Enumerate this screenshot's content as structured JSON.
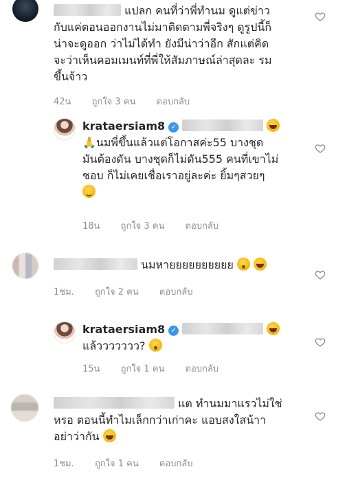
{
  "comments": [
    {
      "username": "",
      "lines": [
        "แปลก คนที่ว่าพี่ทำนม ดูแต่ข่าว",
        "กับแค่ตอนออกงานไม่มาติดตามพี่จริงๆ ดูรูปนี้ก็",
        "น่าจะดูออก ว่าไม่ได้ทำ ยังมีน่าว่าอีก สักแต่คิด",
        "จะว่าเห็นคอมเมนท์ที่พี่ให้สัมภาษณ์ล่าสุดละ รม",
        "ขึ้นจ้าว"
      ],
      "time": "42น",
      "likes": "ถูกใจ 3 คน",
      "reply": "ตอบกลับ"
    },
    {
      "username": "krataersiam8",
      "lines": [
        "นมพี่ขึ้นแล้วแต่โอกาสค่ะ55 บางชุด",
        "มันต้องดัน บางชุดก็ไม่ดัน555 คนที่เขาไม่",
        "ชอบ ก็ไม่เคยเชื่อเราอยู่ละค่ะ ยิ้มๆสวยๆ"
      ],
      "time": "18น",
      "likes": "ถูกใจ 3 คน",
      "reply": "ตอบกลับ"
    },
    {
      "username": "",
      "lines": [
        "นมหายยยยยยยยยย"
      ],
      "time": "1ชม.",
      "likes": "ถูกใจ 2 คน",
      "reply": "ตอบกลับ"
    },
    {
      "username": "krataersiam8",
      "lines": [
        "แล้ววววววว?"
      ],
      "time": "15น",
      "likes": "ถูกใจ 1 คน",
      "reply": "ตอบกลับ"
    },
    {
      "username": "",
      "lines": [
        "แต ทำนมมาแรวไม่ใช่",
        "หรอ ตอนนี้ทำไมเล็กกว่าเก่าคะ แอบสงใสน้าา",
        "อย่าว่ากัน"
      ],
      "time": "1ชม.",
      "likes": "ถูกใจ 1 คน",
      "reply": "ตอบกลับ"
    }
  ],
  "icons": {
    "heart": "heart-outline-icon",
    "verified": "verified-badge-icon",
    "emoji_laugh": "rofl-emoji",
    "emoji_pray": "folded-hands-emoji",
    "emoji_hush": "hushed-face-emoji",
    "emoji_smile": "smiling-face-emoji"
  },
  "colors": {
    "text": "#262626",
    "meta": "#8e8e8e",
    "verified": "#3897f0"
  }
}
